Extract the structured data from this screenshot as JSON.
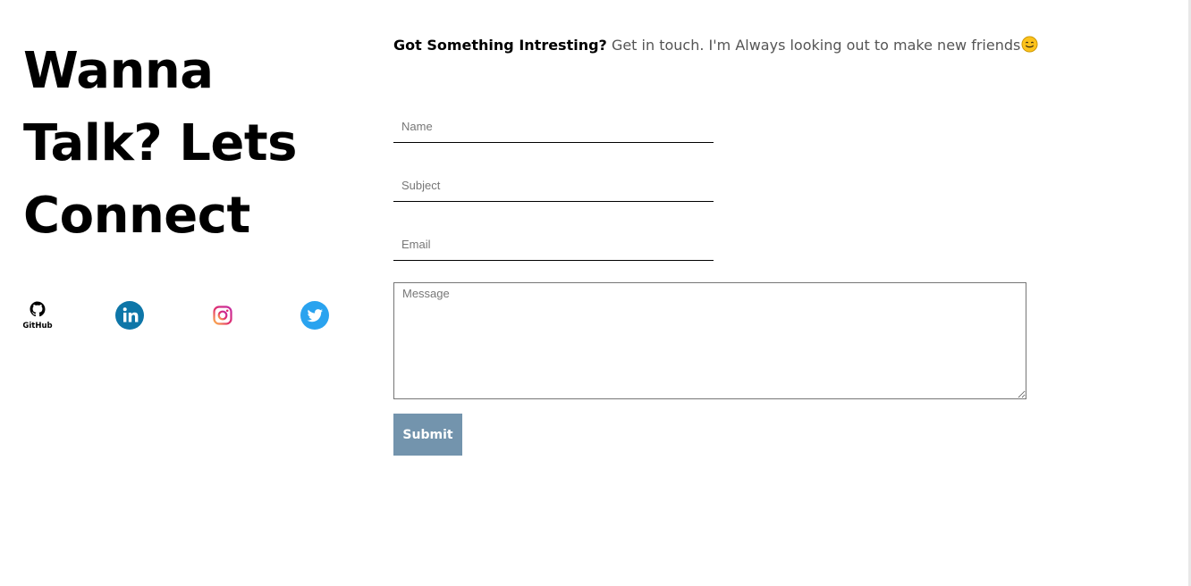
{
  "headline": {
    "line1": "Wanna",
    "line2": "Talk? Lets",
    "line3": "Connect"
  },
  "socials": [
    {
      "name": "GitHub",
      "label": "GitHub",
      "icon": "github-icon",
      "color": "#000000"
    },
    {
      "name": "LinkedIn",
      "icon": "linkedin-icon",
      "color": "#0e76a8"
    },
    {
      "name": "Instagram",
      "icon": "instagram-icon",
      "color": "#d6249f"
    },
    {
      "name": "Twitter",
      "icon": "twitter-icon",
      "color": "#2aa3ef"
    }
  ],
  "contact": {
    "tagline_bold": "Got Something Intresting?",
    "tagline_rest": "Get in touch. I'm Always looking out to make new friends",
    "emoji": "smiling-face-icon",
    "fields": {
      "name_placeholder": "Name",
      "subject_placeholder": "Subject",
      "email_placeholder": "Email",
      "message_placeholder": "Message"
    },
    "submit_label": "Submit",
    "submit_color": "#7394ad"
  }
}
